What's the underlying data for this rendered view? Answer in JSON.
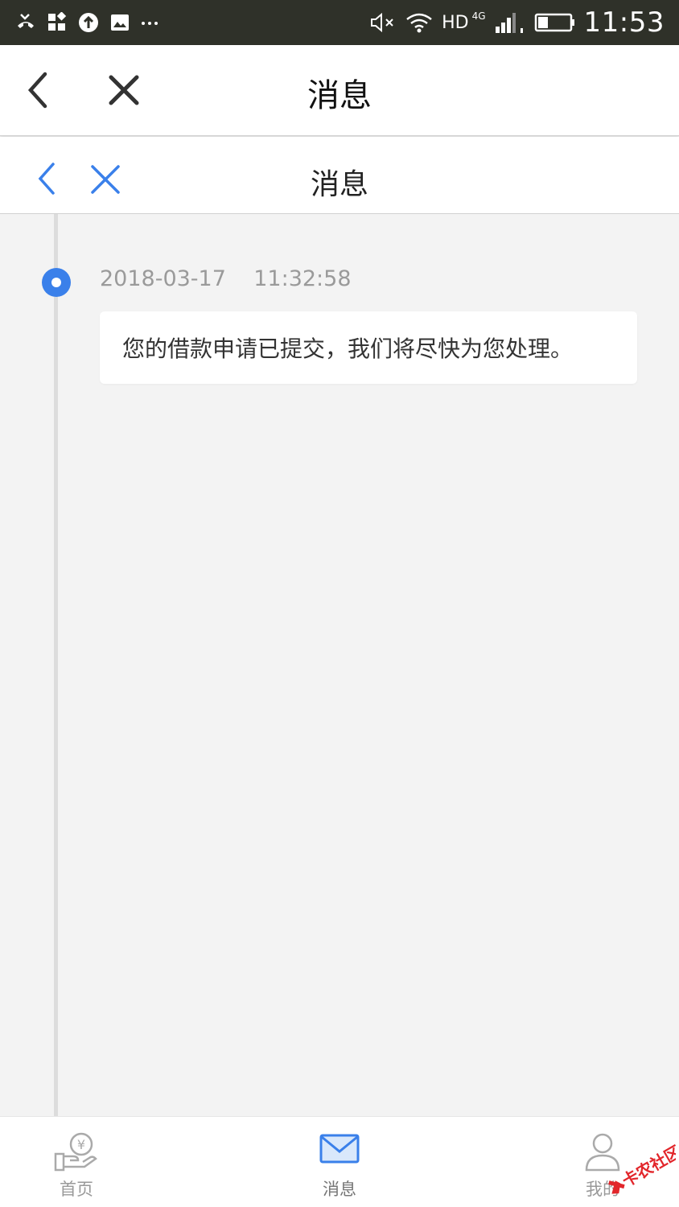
{
  "status_bar": {
    "hd": "HD",
    "network": "4G",
    "time": "11:53"
  },
  "outer_header": {
    "title": "消息"
  },
  "inner_header": {
    "title": "消息"
  },
  "timeline": {
    "entries": [
      {
        "timestamp": "2018-03-17    11:32:58",
        "message": "您的借款申请已提交，我们将尽快为您处理。"
      }
    ]
  },
  "bottom_nav": {
    "items": [
      {
        "label": "首页",
        "icon": "hand-coin-icon"
      },
      {
        "label": "消息",
        "icon": "envelope-icon"
      },
      {
        "label": "我的",
        "icon": "user-icon"
      }
    ]
  },
  "watermark": {
    "text": "卡农社区"
  },
  "colors": {
    "accent": "#3a80ea",
    "status_bar": "#2f3129",
    "background": "#f3f3f3"
  }
}
